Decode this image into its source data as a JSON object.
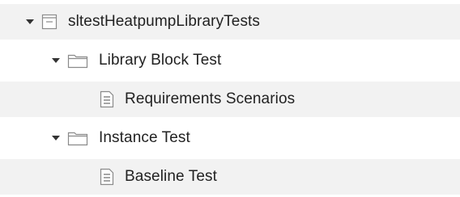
{
  "tree": {
    "root": {
      "label": "sltestHeatpumpLibraryTests",
      "icon": "test-file-icon",
      "expanded": true
    },
    "suites": [
      {
        "label": "Library Block Test",
        "icon": "folder-icon",
        "expanded": true,
        "cases": [
          {
            "label": "Requirements Scenarios",
            "icon": "test-case-icon"
          }
        ]
      },
      {
        "label": "Instance Test",
        "icon": "folder-icon",
        "expanded": true,
        "cases": [
          {
            "label": "Baseline Test",
            "icon": "test-case-icon"
          }
        ]
      }
    ]
  },
  "colors": {
    "row_stripe": "#f2f2f2",
    "text": "#222222",
    "icon_stroke": "#8a8a8a",
    "caret": "#333333"
  }
}
